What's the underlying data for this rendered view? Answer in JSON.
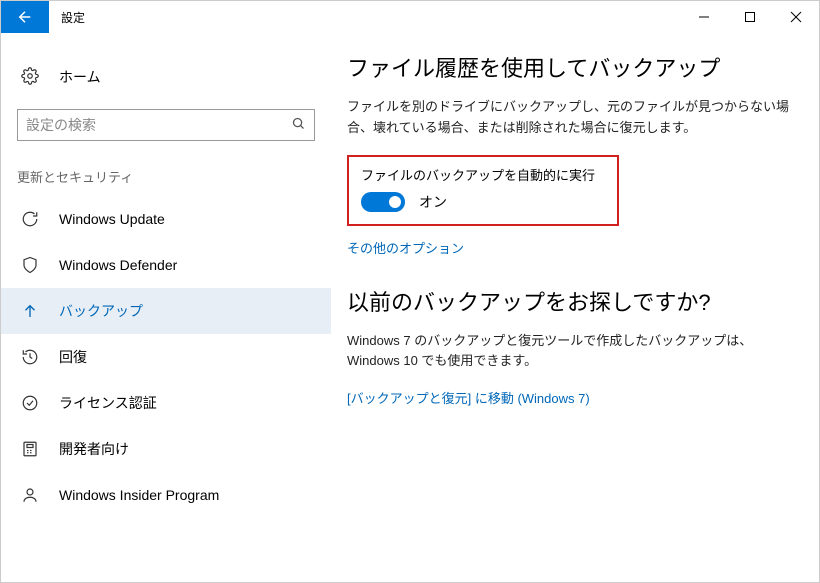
{
  "titlebar": {
    "title": "設定"
  },
  "sidebar": {
    "home": "ホーム",
    "search_placeholder": "設定の検索",
    "section": "更新とセキュリティ",
    "items": [
      {
        "label": "Windows Update"
      },
      {
        "label": "Windows Defender"
      },
      {
        "label": "バックアップ"
      },
      {
        "label": "回復"
      },
      {
        "label": "ライセンス認証"
      },
      {
        "label": "開発者向け"
      },
      {
        "label": "Windows Insider Program"
      }
    ]
  },
  "main": {
    "h1": "ファイル履歴を使用してバックアップ",
    "desc1": "ファイルを別のドライブにバックアップし、元のファイルが見つからない場合、壊れている場合、または削除された場合に復元します。",
    "toggle_label": "ファイルのバックアップを自動的に実行",
    "toggle_state": "オン",
    "link_more": "その他のオプション",
    "h2": "以前のバックアップをお探しですか?",
    "desc2": "Windows 7 のバックアップと復元ツールで作成したバックアップは、Windows 10 でも使用できます。",
    "link_win7": "[バックアップと復元] に移動 (Windows 7)"
  }
}
